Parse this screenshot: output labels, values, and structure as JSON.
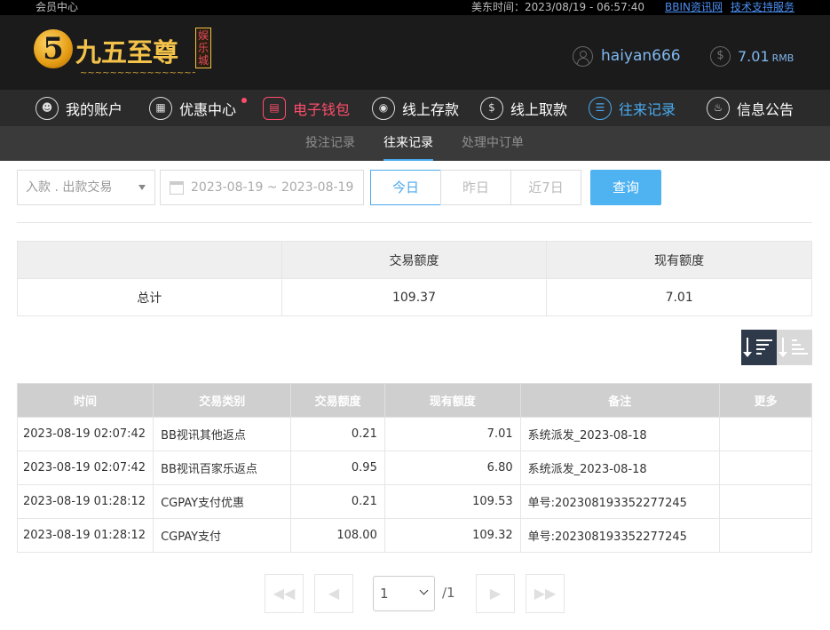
{
  "topbar": {
    "member_center": "会员中心",
    "time": "美东时间：2023/08/19 - 06:57:40",
    "link1": "BBIN资讯网",
    "link2": "技术支持服务"
  },
  "header": {
    "logo_digit": "5",
    "logo_text": "九五至尊",
    "logo_badge": "娱乐城",
    "username": "haiyan666",
    "balance": "7.01",
    "currency": "RMB"
  },
  "mainnav": {
    "items": [
      {
        "label": "我的账户",
        "icon": "user-icon"
      },
      {
        "label": "优惠中心",
        "icon": "gift-icon"
      },
      {
        "label": "电子钱包",
        "icon": "wallet-icon"
      },
      {
        "label": "线上存款",
        "icon": "deposit-icon"
      },
      {
        "label": "线上取款",
        "icon": "withdraw-icon"
      },
      {
        "label": "往来记录",
        "icon": "record-icon"
      },
      {
        "label": "信息公告",
        "icon": "bell-icon"
      }
    ]
  },
  "subnav": {
    "items": [
      "投注记录",
      "往来记录",
      "处理中订单"
    ],
    "active": "往来记录"
  },
  "filters": {
    "type_select": "入款 . 出款交易",
    "date_range": "2023-08-19 ~ 2023-08-19",
    "today": "今日",
    "yesterday": "昨日",
    "last7": "近7日",
    "search": "查询"
  },
  "summary": {
    "headers": [
      "",
      "交易额度",
      "现有额度"
    ],
    "row": [
      "总计",
      "109.37",
      "7.01"
    ]
  },
  "records": {
    "headers": [
      "时间",
      "交易类别",
      "交易额度",
      "现有额度",
      "备注",
      "更多"
    ],
    "rows": [
      [
        "2023-08-19 02:07:42",
        "BB视讯其他返点",
        "0.21",
        "7.01",
        "系统派发_2023-08-18",
        ""
      ],
      [
        "2023-08-19 02:07:42",
        "BB视讯百家乐返点",
        "0.95",
        "6.80",
        "系统派发_2023-08-18",
        ""
      ],
      [
        "2023-08-19 01:28:12",
        "CGPAY支付优惠",
        "0.21",
        "109.53",
        "单号:202308193352277245",
        ""
      ],
      [
        "2023-08-19 01:28:12",
        "CGPAY支付",
        "108.00",
        "109.32",
        "单号:202308193352277245",
        ""
      ]
    ]
  },
  "pagination": {
    "current": "1",
    "total": "/1"
  },
  "colors": {
    "accent": "#4aa9ee",
    "wallet": "#ff4d6a",
    "gold": "#f3c24a"
  }
}
